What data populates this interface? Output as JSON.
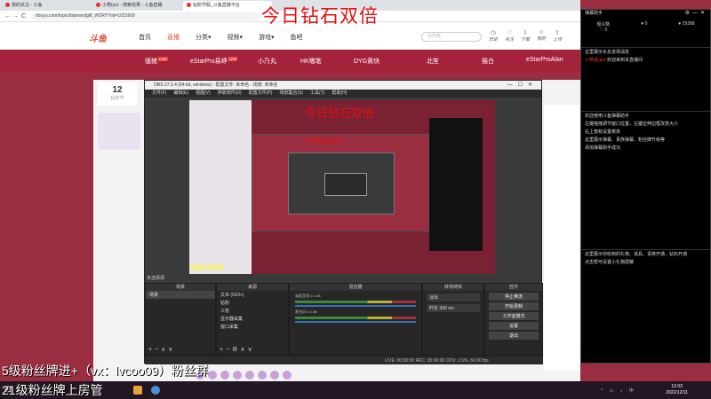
{
  "overlay_title": "今日钻石双倍",
  "browser": {
    "tabs": [
      {
        "label": "我的关注 - 斗鱼"
      },
      {
        "label": "小燕(ps) - 搜索结果 - 斗鱼直播"
      },
      {
        "label": "钻粉节假_斗鱼直播平台"
      }
    ],
    "url": "douyu.com/topic/diamondgift_WZRY?rid=1021609",
    "nav_back": "←",
    "nav_forward": "→",
    "nav_reload": "C"
  },
  "site": {
    "logo": "斗鱼",
    "nav": [
      "首页",
      "直播",
      "分类▾",
      "视频▾",
      "游戏▾",
      "鱼吧"
    ],
    "search_placeholder": "小乃丸",
    "user_links": [
      "历史",
      "关注",
      "下载",
      "我的",
      "上传"
    ],
    "streamers": [
      "骚猪",
      "eStarPro易崢",
      "小乃丸",
      "HK嗷笔",
      "DYG黄玦",
      "北笙",
      "猫白",
      "eStarProAlan"
    ],
    "live_badge": "LIVE",
    "room_number": "12",
    "room_label": "钻粉节"
  },
  "obs": {
    "title": "OBS 27.2.4 (64-bit, windows) - 配置文件: 未命名 - 场景: 未命名",
    "menu": [
      "文件(F)",
      "编辑(E)",
      "视图(V)",
      "停靠部件(D)",
      "配置文件(P)",
      "场景集合(S)",
      "工具(T)",
      "帮助(H)"
    ],
    "preview_overlay": "5级粉丝牌进",
    "preview_title_small": "今日钻石双倍",
    "no_source_selected": "未选择源",
    "docks": {
      "scenes": {
        "header": "场景",
        "items": [
          "场景"
        ]
      },
      "sources": {
        "header": "来源",
        "items": [
          "文本 (GDI+)",
          "钻粉",
          "三张",
          "显示器采集",
          "窗口采集"
        ]
      },
      "mixer": {
        "header": "混音器",
        "tracks": [
          "桌面音频",
          "麦克风"
        ],
        "values": [
          "0.0 dB",
          "0.0 dB"
        ]
      },
      "transitions": {
        "header": "转场特效",
        "type": "淡出",
        "duration_label": "时长",
        "duration": "300 ms"
      },
      "controls": {
        "header": "控件",
        "buttons": [
          "停止推流",
          "开始录制",
          "工作室模式",
          "设置",
          "退出"
        ]
      }
    },
    "status": "LIVE: 00:00:00   REC: 00:00:00   CPU: 2.6%, 60.00 fps"
  },
  "captions": {
    "line1": "5级粉丝牌进+（vx：lvcoo09）粉丝群",
    "line2": "21级粉丝牌上房管"
  },
  "helper": {
    "title": "弹幕助手",
    "stats": [
      {
        "icon": "♡",
        "value": "0"
      },
      {
        "icon": "♥",
        "value": "0"
      },
      {
        "icon": "♥",
        "value": "29388"
      }
    ],
    "stat_labels": [
      "观众数",
      "",
      ""
    ],
    "notice": "这里展示水友进场消息",
    "welcome_user": "小燕进(ps)",
    "welcome_text": "欢迎来到本直播间",
    "help_lines": [
      "欢迎使用斗鱼弹幕助手",
      "左键拖拽调节窗口位置，左键拉伸边框改变大小",
      "右上角有设置菜单",
      "这里展示弹幕、贵族弹幕、粉丝牌升级等",
      "添加弹幕助手成功"
    ],
    "gift_lines": [
      "这里展示你收到的礼物、道具、贵族开通、钻石开通",
      "点击帮可设置小礼物屏蔽"
    ]
  },
  "taskbar": {
    "time": "12:03",
    "date": "2022/12/11"
  }
}
